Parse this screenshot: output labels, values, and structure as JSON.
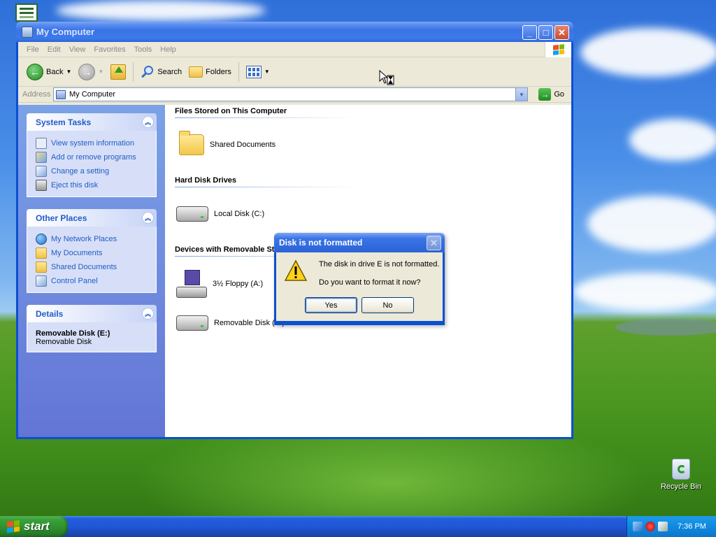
{
  "desktop": {
    "recycle_bin_label": "Recycle Bin"
  },
  "window": {
    "title": "My Computer",
    "menu": [
      "File",
      "Edit",
      "View",
      "Favorites",
      "Tools",
      "Help"
    ],
    "toolbar": {
      "back_label": "Back",
      "search_label": "Search",
      "folders_label": "Folders"
    },
    "address": {
      "label": "Address",
      "value": "My Computer",
      "go_label": "Go"
    }
  },
  "left_pane": {
    "system_tasks": {
      "title": "System Tasks",
      "items": [
        "View system information",
        "Add or remove programs",
        "Change a setting",
        "Eject this disk"
      ]
    },
    "other_places": {
      "title": "Other Places",
      "items": [
        "My Network Places",
        "My Documents",
        "Shared Documents",
        "Control Panel"
      ]
    },
    "details": {
      "title": "Details",
      "name": "Removable Disk (E:)",
      "type": "Removable Disk"
    }
  },
  "content": {
    "groups": [
      {
        "title": "Files Stored on This Computer",
        "items": [
          "Shared Documents"
        ]
      },
      {
        "title": "Hard Disk Drives",
        "items": [
          "Local Disk (C:)"
        ]
      },
      {
        "title": "Devices with Removable Storage",
        "items": [
          "3½ Floppy (A:)",
          "Removable Disk (E:)"
        ]
      }
    ]
  },
  "dialog": {
    "title": "Disk is not formatted",
    "line1": "The disk in drive E is not formatted.",
    "line2": "Do you want to format it now?",
    "yes_label": "Yes",
    "no_label": "No"
  },
  "taskbar": {
    "start_label": "start",
    "clock": "7:36 PM"
  }
}
